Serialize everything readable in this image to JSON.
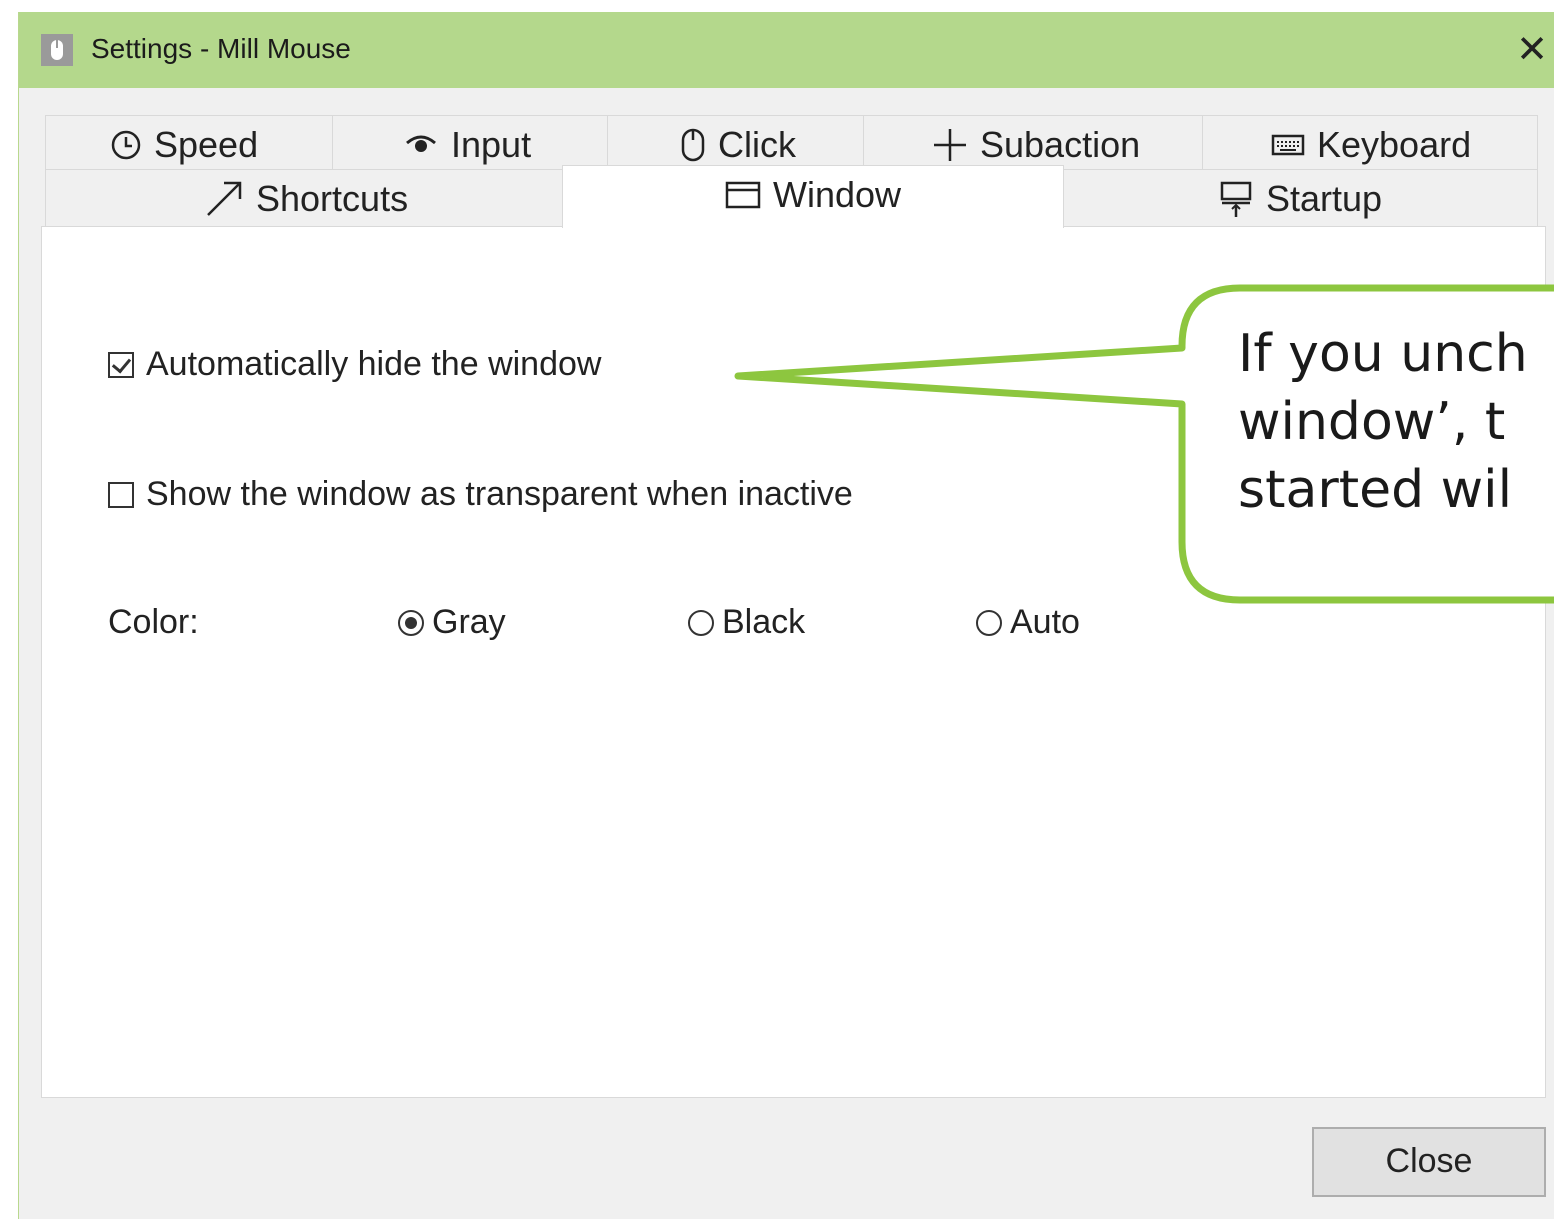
{
  "window": {
    "title": "Settings - Mill Mouse",
    "close_glyph": "✕"
  },
  "tabs_row1": [
    {
      "label": "Speed",
      "icon": "clock-icon",
      "glyph": "🕒"
    },
    {
      "label": "Input",
      "icon": "eye-icon",
      "glyph": "◉"
    },
    {
      "label": "Click",
      "icon": "mouse-icon",
      "glyph": "▯"
    },
    {
      "label": "Subaction",
      "icon": "plus-icon",
      "glyph": "+"
    },
    {
      "label": "Keyboard",
      "icon": "keyboard-icon",
      "glyph": "⌨"
    }
  ],
  "tabs_row2": [
    {
      "label": "Shortcuts",
      "icon": "arrow-up-right-icon",
      "glyph": "↗"
    },
    {
      "label": "Window",
      "icon": "window-icon",
      "glyph": "▭",
      "active": true
    },
    {
      "label": "Startup",
      "icon": "startup-icon",
      "glyph": "⍑"
    }
  ],
  "window_tab": {
    "auto_hide_label": "Automatically hide the window",
    "auto_hide_checked": true,
    "transparent_label": "Show the window as transparent when inactive",
    "transparent_checked": false,
    "color_label": "Color:",
    "color_options": [
      {
        "label": "Gray",
        "selected": true
      },
      {
        "label": "Black",
        "selected": false
      },
      {
        "label": "Auto",
        "selected": false
      }
    ]
  },
  "footer": {
    "close_label": "Close"
  },
  "callout": {
    "lines": [
      "If you unch",
      "window’, t",
      "started wil"
    ],
    "border_color": "#8dc63f"
  },
  "colors": {
    "titlebar": "#b4d88c",
    "window_bg": "#f0f0f0"
  }
}
